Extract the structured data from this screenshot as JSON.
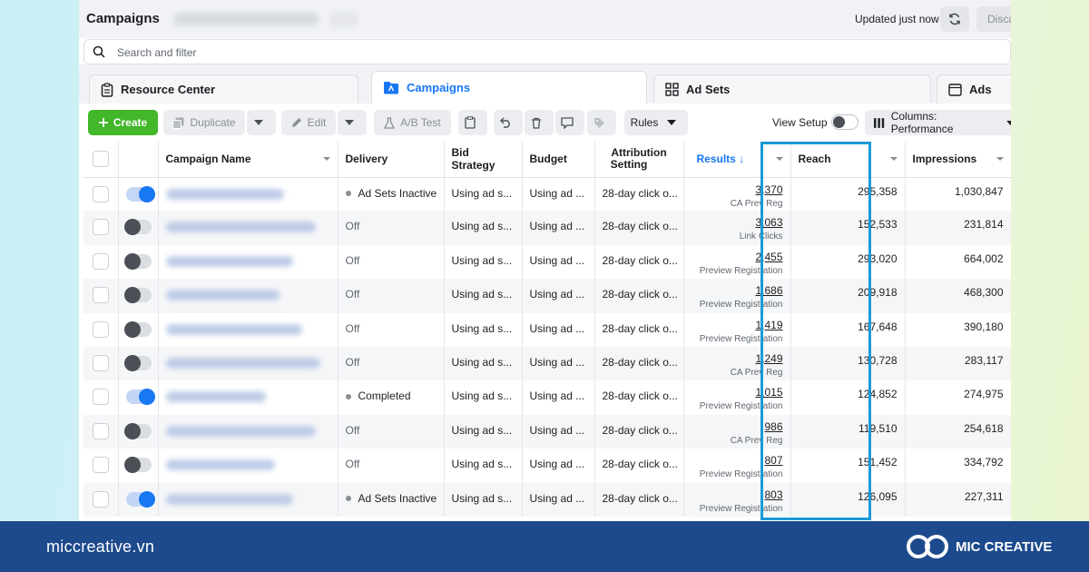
{
  "header": {
    "title": "Campaigns",
    "updated": "Updated just now",
    "discard_label": "Disca"
  },
  "search": {
    "placeholder": "Search and filter"
  },
  "tabs": [
    {
      "label": "Resource Center"
    },
    {
      "label": "Campaigns"
    },
    {
      "label": "Ad Sets"
    },
    {
      "label": "Ads"
    }
  ],
  "toolbar": {
    "create": "Create",
    "duplicate": "Duplicate",
    "edit": "Edit",
    "ab_test": "A/B Test",
    "rules": "Rules",
    "view_setup": "View Setup",
    "columns": "Columns: Performance"
  },
  "table": {
    "headers": {
      "campaign_name": "Campaign Name",
      "delivery": "Delivery",
      "bid_strategy": "Bid Strategy",
      "budget": "Budget",
      "attribution_line1": "Attribution",
      "attribution_line2": "Setting",
      "results": "Results ↓",
      "reach": "Reach",
      "impressions": "Impressions"
    },
    "rows": [
      {
        "on": true,
        "delivery": "Ad Sets Inactive",
        "active_dot": true,
        "bid": "Using ad s...",
        "budget": "Using ad ...",
        "attribution": "28-day click o...",
        "result": "3,370",
        "result_type": "CA Prev Reg",
        "reach": "295,358",
        "impressions": "1,030,847"
      },
      {
        "on": false,
        "delivery": "Off",
        "active_dot": false,
        "bid": "Using ad s...",
        "budget": "Using ad ...",
        "attribution": "28-day click o...",
        "result": "3,063",
        "result_type": "Link Clicks",
        "reach": "152,533",
        "impressions": "231,814"
      },
      {
        "on": false,
        "delivery": "Off",
        "active_dot": false,
        "bid": "Using ad s...",
        "budget": "Using ad ...",
        "attribution": "28-day click o...",
        "result": "2,455",
        "result_type": "Preview Registration",
        "reach": "293,020",
        "impressions": "664,002"
      },
      {
        "on": false,
        "delivery": "Off",
        "active_dot": false,
        "bid": "Using ad s...",
        "budget": "Using ad ...",
        "attribution": "28-day click o...",
        "result": "1,686",
        "result_type": "Preview Registration",
        "reach": "209,918",
        "impressions": "468,300"
      },
      {
        "on": false,
        "delivery": "Off",
        "active_dot": false,
        "bid": "Using ad s...",
        "budget": "Using ad ...",
        "attribution": "28-day click o...",
        "result": "1,419",
        "result_type": "Preview Registration",
        "reach": "167,648",
        "impressions": "390,180"
      },
      {
        "on": false,
        "delivery": "Off",
        "active_dot": false,
        "bid": "Using ad s...",
        "budget": "Using ad ...",
        "attribution": "28-day click o...",
        "result": "1,249",
        "result_type": "CA Prev Reg",
        "reach": "130,728",
        "impressions": "283,117"
      },
      {
        "on": true,
        "delivery": "Completed",
        "active_dot": true,
        "bid": "Using ad s...",
        "budget": "Using ad ...",
        "attribution": "28-day click o...",
        "result": "1,015",
        "result_type": "Preview Registration",
        "reach": "124,852",
        "impressions": "274,975"
      },
      {
        "on": false,
        "delivery": "Off",
        "active_dot": false,
        "bid": "Using ad s...",
        "budget": "Using ad ...",
        "attribution": "28-day click o...",
        "result": "986",
        "result_type": "CA Prev Reg",
        "reach": "119,510",
        "impressions": "254,618"
      },
      {
        "on": false,
        "delivery": "Off",
        "active_dot": false,
        "bid": "Using ad s...",
        "budget": "Using ad ...",
        "attribution": "28-day click o...",
        "result": "807",
        "result_type": "Preview Registration",
        "reach": "151,452",
        "impressions": "334,792"
      },
      {
        "on": true,
        "delivery": "Ad Sets Inactive",
        "active_dot": true,
        "bid": "Using ad s...",
        "budget": "Using ad ...",
        "attribution": "28-day click o...",
        "result": "803",
        "result_type": "Preview Registration",
        "reach": "126,095",
        "impressions": "227,311"
      }
    ]
  },
  "footer": {
    "site": "miccreative.vn",
    "brand": "MIC CREATIVE"
  },
  "colors": {
    "accent": "#1877f2",
    "create_green": "#42b72a",
    "highlight": "#1a9ad6",
    "footer_bg": "#1d4a8c"
  }
}
